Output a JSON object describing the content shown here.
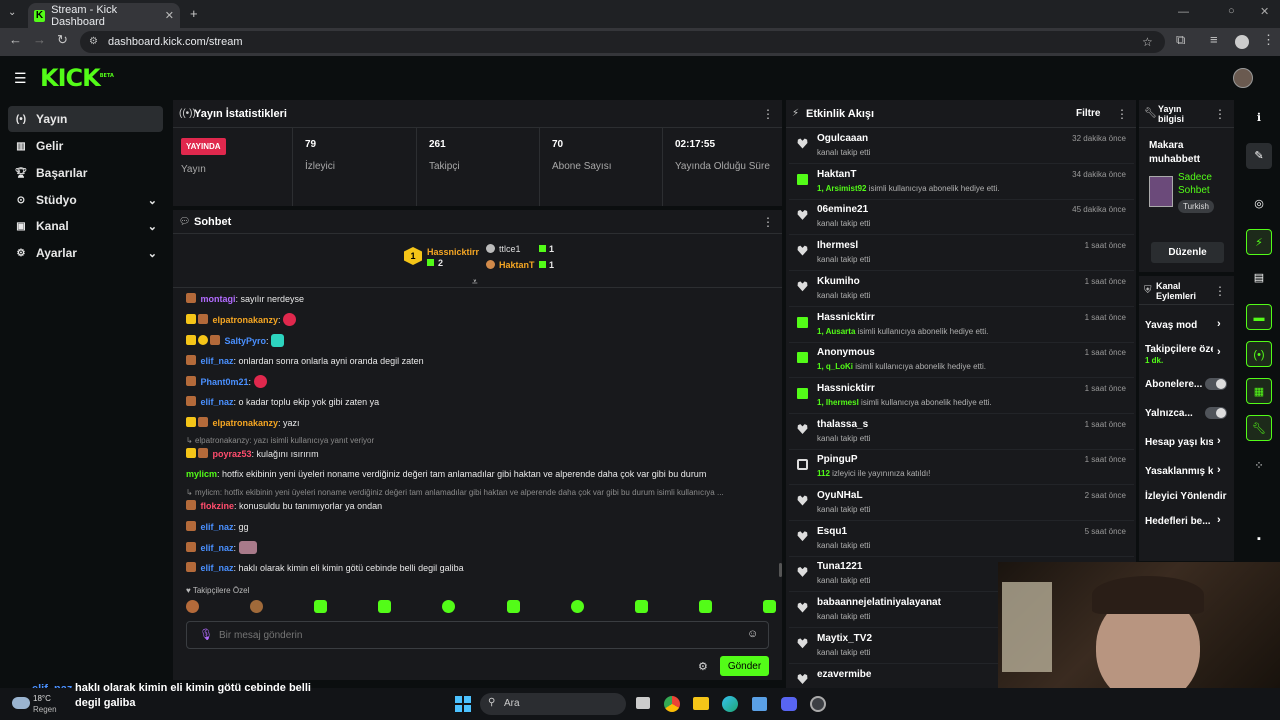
{
  "browser": {
    "tab_title": "Stream - Kick Dashboard",
    "url": "dashboard.kick.com/stream"
  },
  "brand": {
    "logo": "KICK",
    "logo_tag": "BETA",
    "accent": "#53fc18"
  },
  "sidebar": {
    "items": [
      {
        "label": "Yayın",
        "icon": "broadcast-icon"
      },
      {
        "label": "Gelir",
        "icon": "revenue-icon"
      },
      {
        "label": "Başarılar",
        "icon": "trophy-icon"
      },
      {
        "label": "Stüdyo",
        "icon": "studio-icon"
      },
      {
        "label": "Kanal",
        "icon": "channel-icon"
      },
      {
        "label": "Ayarlar",
        "icon": "settings-icon"
      }
    ]
  },
  "stats": {
    "title": "Yayın İstatistikleri",
    "live_badge": "YAYINDA",
    "live_label": "Yayın",
    "items": [
      {
        "value": "79",
        "label": "İzleyici"
      },
      {
        "value": "261",
        "label": "Takipçi"
      },
      {
        "value": "70",
        "label": "Abone Sayısı"
      },
      {
        "value": "02:17:55",
        "label": "Yayında Olduğu Süre"
      }
    ]
  },
  "chat": {
    "title": "Sohbet",
    "leader": {
      "name": "Hassnicktirr",
      "rank": "1",
      "count": "2"
    },
    "top": [
      {
        "name": "ttlce1",
        "count": "1"
      },
      {
        "name": "HaktanT",
        "count": "1"
      }
    ],
    "messages": [
      {
        "user": "montagi",
        "text": ": sayılır nerdeyse",
        "color": "#b26bff"
      },
      {
        "user": "elpatronakanzy",
        "text": ":",
        "color": "#f5a623"
      },
      {
        "user": "SaltyPyro",
        "text": ":",
        "color": "#4a90ff"
      },
      {
        "user": "elif_naz",
        "text": ": onlardan sonra onlarla ayni oranda degil zaten",
        "color": "#4a90ff"
      },
      {
        "user": "Phant0m21",
        "text": ":",
        "color": "#4a90ff"
      },
      {
        "user": "elif_naz",
        "text": ": o kadar toplu ekip yok gibi zaten ya",
        "color": "#4a90ff"
      },
      {
        "user": "elpatronakanzy",
        "text": ": yazı",
        "color": "#f5a623"
      },
      {
        "user": "poyraz53",
        "text": ": kulağını ısırırım",
        "color": "#ff4d6d",
        "reply": "elpatronakanzy: yazı isimli kullanıcıya yanıt veriyor"
      },
      {
        "user": "mylicm",
        "text": ": hotfix ekibinin yeni üyeleri noname verdiğiniz değeri tam anlamadılar gibi haktan ve alperende daha çok var gibi bu durum",
        "color": "#53fc18"
      },
      {
        "user": "flokzine",
        "text": ": konusuldu bu tanımıyorlar ya ondan",
        "color": "#ff4d6d",
        "reply": "mylicm: hotfix ekibinin yeni üyeleri noname verdiğiniz değeri tam anlamadılar gibi haktan ve alperende daha çok var gibi bu durum isimli kullanıcıya ..."
      },
      {
        "user": "elif_naz",
        "text": ": gg",
        "color": "#4a90ff"
      },
      {
        "user": "elif_naz",
        "text": ":",
        "color": "#4a90ff"
      },
      {
        "user": "elif_naz",
        "text": ": haklı olarak kimin eli kimin götü cebinde belli degil galiba",
        "color": "#4a90ff"
      }
    ],
    "followers_only": "Takipçilere Özel",
    "input_placeholder": "Bir mesaj gönderin",
    "send_label": "Gönder"
  },
  "events": {
    "title": "Etkinlik Akışı",
    "filter_label": "Filtre",
    "items": [
      {
        "type": "follow",
        "name": "Ogulcaaan",
        "sub": "kanalı takip etti",
        "time": "32 dakika önce"
      },
      {
        "type": "gift",
        "name": "HaktanT",
        "sub_bold": "1, Arsimist92",
        "sub": " isimli kullanıcıya abonelik hediye etti.",
        "time": "34 dakika önce"
      },
      {
        "type": "follow",
        "name": "06emine21",
        "sub": "kanalı takip etti",
        "time": "45 dakika önce"
      },
      {
        "type": "follow",
        "name": "Ihermesl",
        "sub": "kanalı takip etti",
        "time": "1 saat önce"
      },
      {
        "type": "follow",
        "name": "Kkumiho",
        "sub": "kanalı takip etti",
        "time": "1 saat önce"
      },
      {
        "type": "gift",
        "name": "Hassnicktirr",
        "sub_bold": "1, Ausarta",
        "sub": " isimli kullanıcıya abonelik hediye etti.",
        "time": "1 saat önce"
      },
      {
        "type": "gift",
        "name": "Anonymous",
        "sub_bold": "1, q_LoKi",
        "sub": " isimli kullanıcıya abonelik hediye etti.",
        "time": "1 saat önce"
      },
      {
        "type": "gift",
        "name": "Hassnicktirr",
        "sub_bold": "1, Ihermesl",
        "sub": " isimli kullanıcıya abonelik hediye etti.",
        "time": "1 saat önce"
      },
      {
        "type": "follow",
        "name": "thalassa_s",
        "sub": "kanalı takip etti",
        "time": "1 saat önce"
      },
      {
        "type": "host",
        "name": "PpinguP",
        "sub_bold": "112",
        "sub": " izleyici ile yayınınıza katıldı!",
        "time": "1 saat önce"
      },
      {
        "type": "follow",
        "name": "OyuNHaL",
        "sub": "kanalı takip etti",
        "time": "2 saat önce"
      },
      {
        "type": "follow",
        "name": "Esqu1",
        "sub": "kanalı takip etti",
        "time": "5 saat önce"
      },
      {
        "type": "follow",
        "name": "Tuna1221",
        "sub": "kanalı takip etti",
        "time": ""
      },
      {
        "type": "follow",
        "name": "babaannejelatiniyalayanat",
        "sub": "kanalı takip etti",
        "time": ""
      },
      {
        "type": "follow",
        "name": "Maytix_TV2",
        "sub": "kanalı takip etti",
        "time": ""
      },
      {
        "type": "follow",
        "name": "ezavermibe",
        "sub": "",
        "time": ""
      }
    ]
  },
  "stream_info": {
    "title": "Yayın bilgisi",
    "stream_title": "Makara muhabbett",
    "category": "Sadece Sohbet",
    "language_tag": "Turkish",
    "edit_label": "Düzenle"
  },
  "channel_actions": {
    "title": "Kanal Eylemleri",
    "items": [
      {
        "label": "Yavaş mod",
        "control": "chevron"
      },
      {
        "label": "Takipçilere öze",
        "sub": "1 dk.",
        "control": "chevron"
      },
      {
        "label": "Abonelere...",
        "control": "toggle"
      },
      {
        "label": "Yalnızca...",
        "control": "toggle"
      },
      {
        "label": "Hesap yaşı kısı",
        "control": "chevron"
      },
      {
        "label": "Yasaklanmış kı",
        "control": "chevron"
      },
      {
        "label": "İzleyici Yönlendir",
        "control": "none"
      },
      {
        "label": "Hedefleri be...",
        "control": "chevron"
      }
    ]
  },
  "overlay": {
    "chat_user": "elif_naz",
    "chat_text": "haklı olarak kimin eli kimin götü cebinde belli degil galiba"
  },
  "taskbar": {
    "weather_temp": "18°C",
    "weather_desc": "Regen",
    "search_label": "Ara"
  }
}
